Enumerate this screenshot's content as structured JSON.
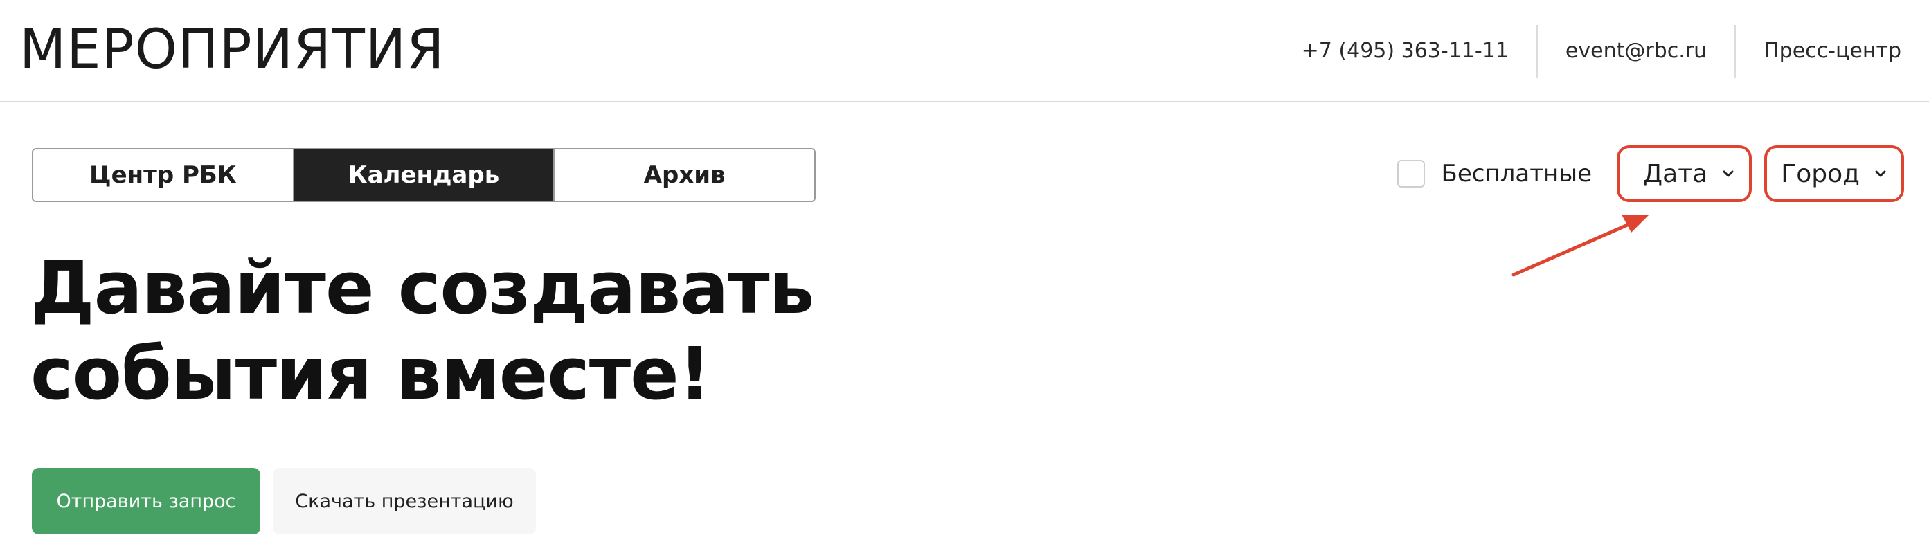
{
  "header": {
    "logo": "МЕРОПРИЯТИЯ",
    "phone": "+7 (495) 363-11-11",
    "email": "event@rbc.ru",
    "press": "Пресс-центр"
  },
  "tabs": [
    {
      "label": "Центр РБК",
      "active": false
    },
    {
      "label": "Календарь",
      "active": true
    },
    {
      "label": "Архив",
      "active": false
    }
  ],
  "filters": {
    "free_label": "Бесплатные",
    "free_checked": false,
    "date_label": "Дата",
    "city_label": "Город",
    "icons": {
      "dropdown": "chevron-down-icon"
    }
  },
  "hero": {
    "line1": "Давайте создавать",
    "line2": "события вместе!"
  },
  "buttons": {
    "send_request": "Отправить запрос",
    "download_presentation": "Скачать презентацию"
  },
  "colors": {
    "accent_green": "#47a164",
    "annotation_red": "#de4430",
    "active_tab": "#222222"
  }
}
